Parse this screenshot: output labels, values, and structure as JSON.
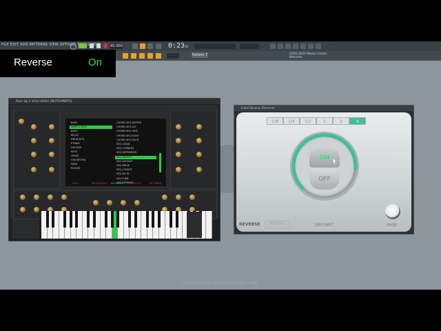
{
  "overlay": {
    "label": "Reverse",
    "value": "On"
  },
  "fl": {
    "menu": "FILE  EDIT  ADD  PATTERNS  VIEW  OPTIONS  TOOLS  HELP",
    "tempo": "95.000",
    "time": "0:23",
    "time_sub": "30",
    "pattern": "Pattern 7",
    "hint_title": "03/03  DAZA Wazzy Control",
    "hint_body": "Welcome",
    "footer": "Producer Edition v20.0.5 [build 681] - 64Bit"
  },
  "synth": {
    "title": "Reen Sip 2 Initial (64bit) (INSTRUMENTS)",
    "browser_left": [
      "BASS",
      "ARPS & SEQS",
      "BASS",
      "BELLS",
      "DRUM KITS",
      "ETHNIC",
      "GUITARS",
      "KEYS",
      "LEADS",
      "ORCHESTRA",
      "PADS",
      "PLUCKS"
    ],
    "browser_right": [
      "CHORD SEQ BUFFER",
      "CHORD SEQ ALT",
      "CHORD SEQ HIGH",
      "CHORD SEQ ECHO",
      "CHORD SEQ VALID",
      "SEQ CHASE",
      "SEQ CORNERS",
      "SEQ DEPRESSED",
      "SEQ DESPOT",
      "SEQ DISTANT",
      "SEQ DRIVE",
      "SEQ LOYALTY",
      "SEQ NO ID",
      "SEQ FUNK",
      "SEQ REMIXED"
    ],
    "tabs": [
      "OSCS",
      "SEQUENCER",
      "BROWSER",
      "EFFECTS",
      "SETTINGS"
    ]
  },
  "reverse": {
    "title": "Initial Reverse (Reverse)",
    "segments": [
      "1/8",
      "1/4",
      "1/2",
      "1",
      "2",
      "4"
    ],
    "active_segment": 5,
    "on_label": "ON",
    "off_label": "OFF",
    "brand": "REVERSE",
    "preset": "INITIAL",
    "drywet_label": "DRY/WET",
    "fade_label": "FADE",
    "accent": "#3fbf95",
    "dry_wet": 0.85
  }
}
